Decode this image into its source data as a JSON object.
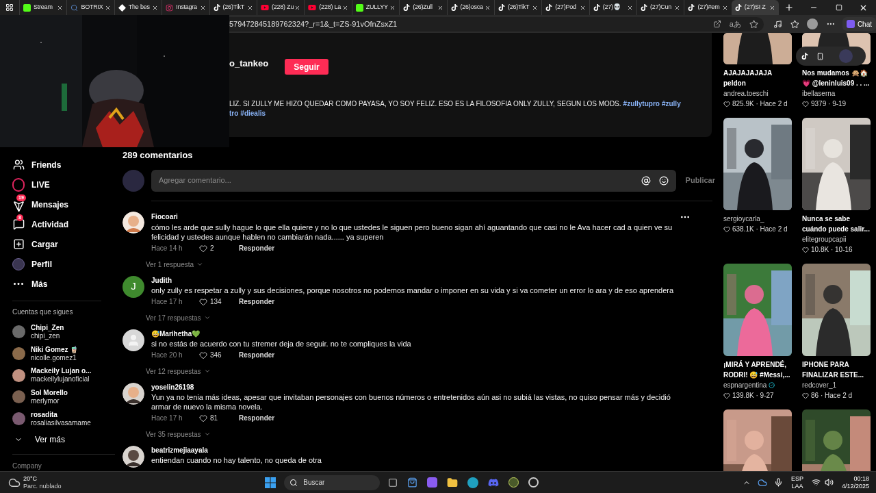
{
  "browser": {
    "tabs": [
      {
        "title": "Stream",
        "kind": "kick",
        "selected": false
      },
      {
        "title": "BOTRIX",
        "kind": "search",
        "selected": false
      },
      {
        "title": "The bes",
        "kind": "diamond",
        "selected": false
      },
      {
        "title": "Instagra",
        "kind": "instagram",
        "selected": false
      },
      {
        "title": "(26)TikT",
        "kind": "tiktok",
        "selected": false
      },
      {
        "title": "(228) Zu",
        "kind": "youtube",
        "selected": false
      },
      {
        "title": "(228) La",
        "kind": "youtube",
        "selected": false
      },
      {
        "title": "ZULLYY",
        "kind": "kick",
        "selected": false
      },
      {
        "title": "(26)Zull",
        "kind": "tiktok",
        "selected": false
      },
      {
        "title": "(26)osca",
        "kind": "tiktok",
        "selected": false
      },
      {
        "title": "(26)TikT",
        "kind": "tiktok",
        "selected": false
      },
      {
        "title": "(27)Pod",
        "kind": "tiktok",
        "selected": false
      },
      {
        "title": "(27)💀",
        "kind": "tiktok",
        "selected": false
      },
      {
        "title": "(27)Cun",
        "kind": "tiktok",
        "selected": false
      },
      {
        "title": "(27)#em",
        "kind": "tiktok",
        "selected": false
      },
      {
        "title": "(27)SI Z",
        "kind": "tiktok",
        "selected": true
      }
    ],
    "address": "579472845189762324?_r=1&_t=ZS-91vOfnZsxZ1",
    "read_aloud": "aあ",
    "chat_button": "Chat"
  },
  "sidebar": {
    "nav": [
      {
        "label": "Friends",
        "kind": "friends"
      },
      {
        "label": "LIVE",
        "kind": "live"
      },
      {
        "label": "Mensajes",
        "kind": "messages",
        "badge": "19"
      },
      {
        "label": "Actividad",
        "kind": "activity",
        "badge": "8"
      },
      {
        "label": "Cargar",
        "kind": "upload"
      },
      {
        "label": "Perfil",
        "kind": "profile"
      },
      {
        "label": "Más",
        "kind": "more"
      }
    ],
    "following_title": "Cuentas que sigues",
    "following": [
      {
        "name": "Chipi_Zen",
        "handle": "chipi_zen"
      },
      {
        "name": "Niki Gomez 🧋",
        "handle": "nicolle.gomez1"
      },
      {
        "name": "Mackeily Lujan o...",
        "handle": "mackeilylujanoficial"
      },
      {
        "name": "Sol Morello",
        "handle": "merlymor"
      },
      {
        "name": "rosadita",
        "handle": "rosaliasilvasamame"
      }
    ],
    "see_more": "Ver más",
    "footer": "Company"
  },
  "post": {
    "username": "o_tankeo",
    "follow_button": "Seguir",
    "description_lines": [
      [
        {
          "kind": "text",
          "text": "LIZ. SI ZULLY ME HIZO QUEDAR COMO PAYASA, YO SOY FELIZ. ESO ES LA FILOSOFIA ONLY ZULLY, SEGUN LOS MODS."
        },
        {
          "kind": "hashtag",
          "text": "#zullytupro"
        },
        {
          "kind": "hashtag",
          "text": "#zully"
        }
      ],
      [
        {
          "kind": "hashtag",
          "text": "tro"
        },
        {
          "kind": "hashtag",
          "text": "#diealis"
        }
      ]
    ]
  },
  "comments": {
    "count_label": "289 comentarios",
    "input_placeholder": "Agregar comentario...",
    "publish_button": "Publicar",
    "items": [
      {
        "user": "Fiocoari",
        "kind": "picture",
        "text": "cómo les arde que sully hague lo que ella quiere y no lo que ustedes le siguen pero bueno sigan ahí aguantando que casi no le Ava hacer cad a quien ve su felicidad y ustedes aunque hablen no cambiarán nada...... ya superen",
        "time": "Hace 14 h",
        "likes": "2",
        "reply": "Responder",
        "replies_toggle": "Ver 1 respuesta",
        "show_menu": true
      },
      {
        "user": "Judith",
        "kind": "letter",
        "avatar_letter": "J",
        "text": "only zully es respetar a zully y sus decisiones, porque nosotros no podemos mandar o imponer en su vida y si va cometer un error lo ara y de eso aprendera",
        "time": "Hace 17 h",
        "likes": "134",
        "reply": "Responder",
        "replies_toggle": "Ver 17 respuestas",
        "show_menu": false
      },
      {
        "user": "😅Marihetha💚",
        "kind": "default",
        "text": "si no estás de acuerdo con tu stremer deja de seguir. no te compliques la vida",
        "time": "Hace 20 h",
        "likes": "346",
        "reply": "Responder",
        "replies_toggle": "Ver 12 respuestas",
        "show_menu": false
      },
      {
        "user": "yoselin26198",
        "kind": "picture",
        "text": "Yun ya no tenia más ideas, apesar que invitaban personajes con buenos números o entretenidos aún asi no subiá las vistas, no quiso pensar más y decidió armar de nuevo la misma novela.",
        "time": "Hace 17 h",
        "likes": "81",
        "reply": "Responder",
        "replies_toggle": "Ver 35 respuestas",
        "show_menu": false
      },
      {
        "user": "beatrizmejiaayala",
        "kind": "picture",
        "text": "entiendan cuando no hay talento, no queda de otra",
        "show_menu": false
      }
    ]
  },
  "recommended": [
    {
      "kind": "video",
      "title": "AJAJAJAJAJA peldon",
      "author": "andrea.toeschi",
      "stats": "825.9K · Hace 2 d",
      "verified": false
    },
    {
      "kind": "video",
      "title": "Nos mudamos 🙊🏠 💗 @leninluis09 . . ...",
      "author": "ibellaserna",
      "stats": "9379 · 9-19",
      "verified": false
    },
    {
      "kind": "video",
      "author": "sergioycarla_",
      "stats": "638.1K · Hace 2 d",
      "verified": false
    },
    {
      "kind": "video",
      "title": "Nunca se sabe cuándo puede salir...",
      "author": "elitegroupcapii",
      "stats": "10.8K · 10-16",
      "verified": false
    },
    {
      "kind": "video",
      "title": "¡MIRÁ Y APRENDÉ, RODRI! 😅 #Messi,...",
      "author": "espnargentina",
      "stats": "139.8K · 9-27",
      "verified": true
    },
    {
      "kind": "video",
      "title": "IPHONE PARA FINALIZAR ESTE...",
      "author": "redcover_1",
      "stats": "86 · Hace 2 d",
      "verified": false
    },
    {
      "kind": "picture"
    },
    {
      "kind": "picture"
    }
  ],
  "taskbar": {
    "weather_temp": "20°C",
    "weather_desc": "Parc. nublado",
    "search": "Buscar",
    "lang": "ESP",
    "layout": "LAA",
    "time": "00:18",
    "date": "4/12/2025"
  }
}
